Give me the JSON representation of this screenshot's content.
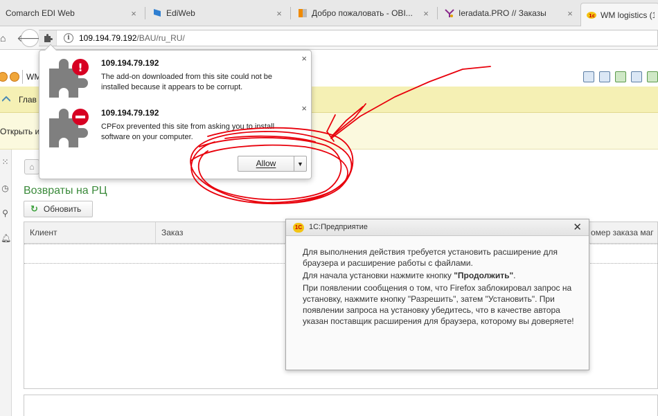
{
  "browser": {
    "tabs": [
      {
        "title": "Comarch EDI Web",
        "active": false
      },
      {
        "title": "EdiWeb",
        "active": false
      },
      {
        "title": "Добро пожаловать - OBI...",
        "active": false
      },
      {
        "title": "Ieradata.PRO // Заказы",
        "active": false
      },
      {
        "title": "WM logistics (1",
        "active": true
      }
    ],
    "tab_close_glyph": "×",
    "url_host": "109.194.79.192",
    "url_path": "/BAU/ru_RU/"
  },
  "addon_popup": {
    "notices": [
      {
        "host": "109.194.79.192",
        "message": "The add-on downloaded from this site could not be installed because it appears to be corrupt.",
        "badge": "!",
        "badge_color": "#d70022"
      },
      {
        "host": "109.194.79.192",
        "message": "CPFox prevented this site from asking you to install software on your computer.",
        "badge": "–",
        "badge_color": "#d70022"
      }
    ],
    "allow_label": "Allow",
    "dropdown_glyph": "▼",
    "close_glyph": "×"
  },
  "app": {
    "toolbar_label": "WM",
    "menu_main_label": "Глав",
    "open_label": "Открыть и",
    "section_title": "Возвраты на РЦ",
    "refresh_label": "Обновить",
    "grid_columns": [
      "Клиент",
      "Заказ",
      "омер заказа маг"
    ]
  },
  "dialog": {
    "title": "1С:Предприятие",
    "logo_text": "1С",
    "close_glyph": "✕",
    "para1": "Для выполнения действия требуется установить расширение для браузера и расширение работы с файлами.",
    "para2_prefix": "Для начала установки нажмите кнопку ",
    "para2_bold": "\"Продолжить\"",
    "para2_suffix": ".",
    "para3": "При появлении сообщения о том, что Firefox заблокировал запрос на установку, нажмите кнопку \"Разрешить\", затем \"Установить\". При появлении запроса на установку убедитесь, что в качестве автора указан поставщик расширения для браузера, которому вы доверяете!"
  },
  "colors": {
    "accent_green": "#3a8a3a",
    "menu_band": "#f5f0b4",
    "annotation_red": "#e8000b"
  }
}
